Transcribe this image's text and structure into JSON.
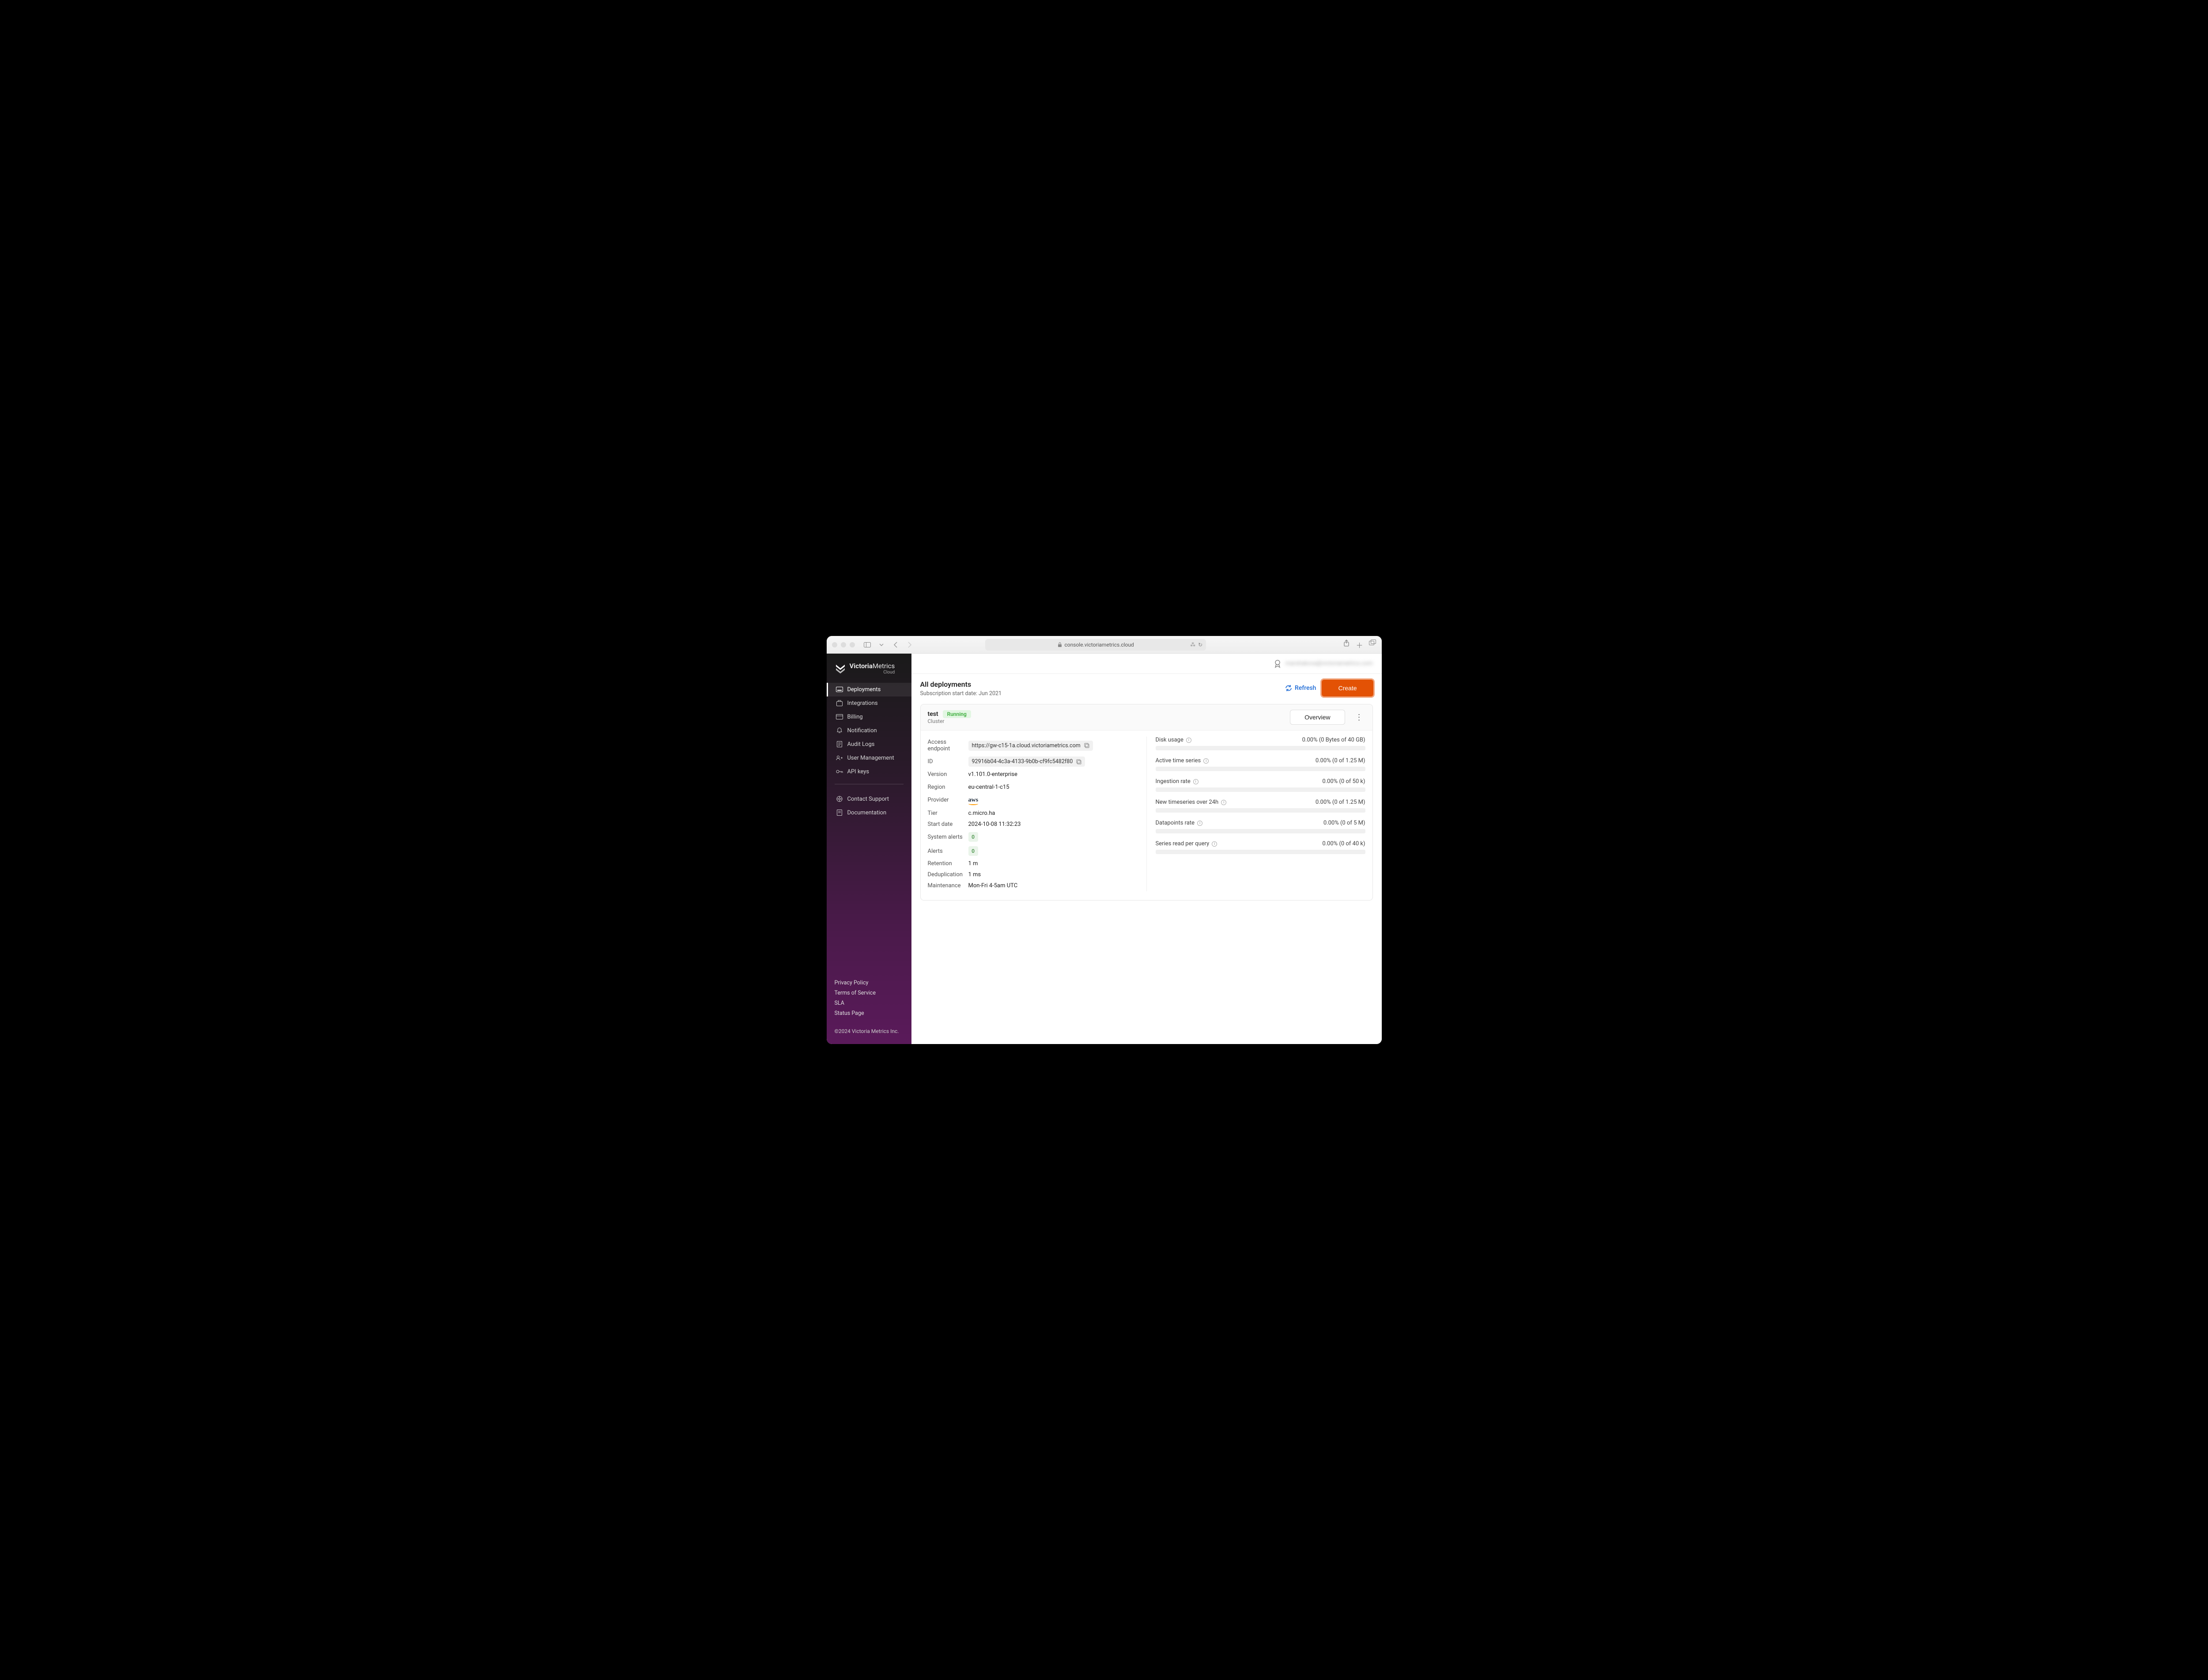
{
  "browser": {
    "url": "console.victoriametrics.cloud"
  },
  "brand": {
    "name_bold": "Victoria",
    "name_rest": "Metrics",
    "subtitle": "Cloud"
  },
  "user": {
    "email": "marshakova@victoriametrics.com"
  },
  "sidebar": {
    "items": [
      {
        "label": "Deployments",
        "name": "sidebar-item-deployments",
        "active": true
      },
      {
        "label": "Integrations",
        "name": "sidebar-item-integrations",
        "active": false
      },
      {
        "label": "Billing",
        "name": "sidebar-item-billing",
        "active": false
      },
      {
        "label": "Notification",
        "name": "sidebar-item-notification",
        "active": false
      },
      {
        "label": "Audit Logs",
        "name": "sidebar-item-audit-logs",
        "active": false
      },
      {
        "label": "User Management",
        "name": "sidebar-item-user-management",
        "active": false
      },
      {
        "label": "API keys",
        "name": "sidebar-item-api-keys",
        "active": false
      }
    ],
    "support": [
      {
        "label": "Contact Support",
        "name": "sidebar-item-contact-support"
      },
      {
        "label": "Documentation",
        "name": "sidebar-item-documentation"
      }
    ],
    "footer": {
      "privacy": "Privacy Policy",
      "tos": "Terms of Service",
      "sla": "SLA",
      "status": "Status Page",
      "copyright": "©2024 Victoria Metrics Inc."
    }
  },
  "page": {
    "title": "All deployments",
    "subscription_label": "Subscription start date: Jun 2021",
    "refresh_label": "Refresh",
    "create_label": "Create"
  },
  "deployment": {
    "name": "test",
    "type": "Cluster",
    "status": "Running",
    "overview_label": "Overview",
    "details": {
      "access_endpoint": {
        "label": "Access endpoint",
        "value": "https://gw-c15-1a.cloud.victoriametrics.com"
      },
      "id": {
        "label": "ID",
        "value": "92916b04-4c3a-4133-9b0b-cf9fc5482f80"
      },
      "version": {
        "label": "Version",
        "value": "v1.101.0-enterprise"
      },
      "region": {
        "label": "Region",
        "value": "eu-central-1-c15"
      },
      "provider": {
        "label": "Provider",
        "value": "aws"
      },
      "tier": {
        "label": "Tier",
        "value": "c.micro.ha"
      },
      "start_date": {
        "label": "Start date",
        "value": "2024-10-08 11:32:23"
      },
      "system_alerts": {
        "label": "System alerts",
        "value": "0"
      },
      "alerts": {
        "label": "Alerts",
        "value": "0"
      },
      "retention": {
        "label": "Retention",
        "value": "1 m"
      },
      "deduplication": {
        "label": "Deduplication",
        "value": "1 ms"
      },
      "maintenance": {
        "label": "Maintenance",
        "value": "Mon-Fri 4-5am UTC"
      }
    },
    "metrics": [
      {
        "name": "Disk usage",
        "value": "0.00% (0 Bytes of 40 GB)"
      },
      {
        "name": "Active time series",
        "value": "0.00% (0 of 1.25 M)"
      },
      {
        "name": "Ingestion rate",
        "value": "0.00% (0 of 50 k)"
      },
      {
        "name": "New timeseries over 24h",
        "value": "0.00% (0 of 1.25 M)"
      },
      {
        "name": "Datapoints rate",
        "value": "0.00% (0 of 5 M)"
      },
      {
        "name": "Series read per query",
        "value": "0.00% (0 of 40 k)"
      }
    ]
  }
}
